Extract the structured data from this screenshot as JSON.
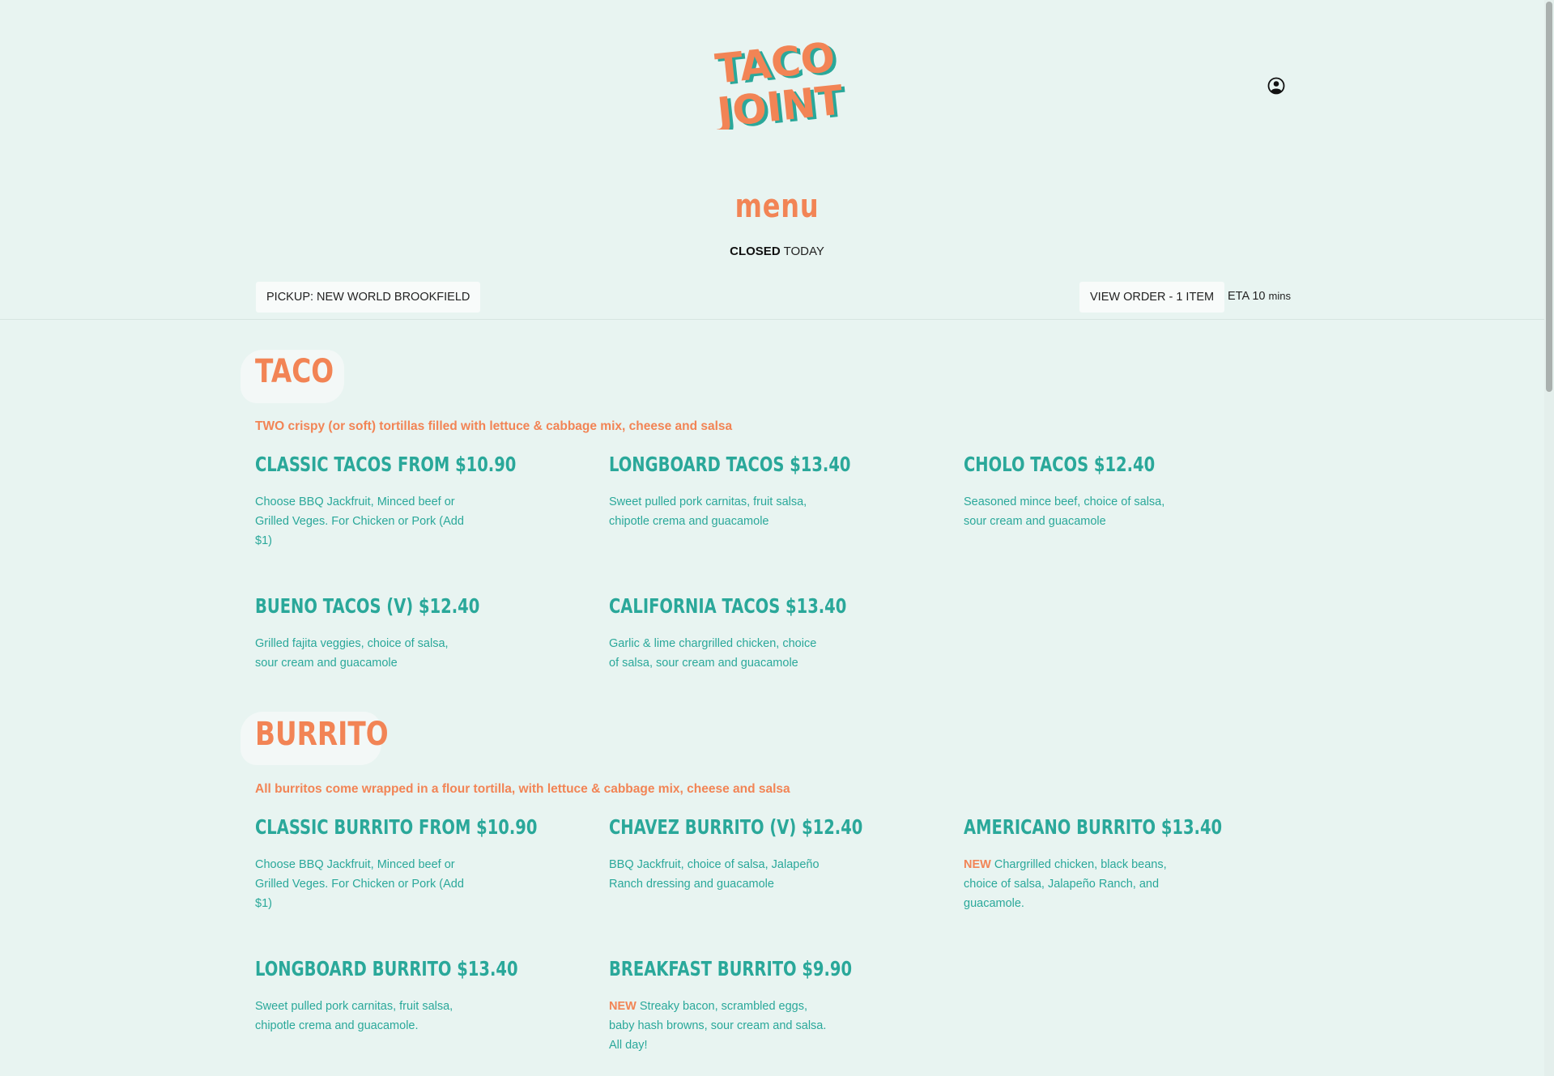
{
  "header": {
    "logo_line1": "TACO",
    "logo_line2": "JOINT"
  },
  "page_title": "menu",
  "status": {
    "closed": "CLOSED",
    "day": "TODAY"
  },
  "pickup_label": "PICKUP: NEW WORLD BROOKFIELD",
  "order_label": "VIEW ORDER - 1 ITEM",
  "eta": {
    "label": "ETA 10",
    "unit": "mins"
  },
  "colors": {
    "background": "#e8f4f1",
    "accent_orange": "#f28455",
    "accent_teal": "#2aa89a"
  },
  "categories": [
    {
      "name": "TACO",
      "description": "TWO crispy (or soft) tortillas filled with lettuce & cabbage mix, cheese and salsa",
      "items": [
        {
          "title": "Classic Tacos from $10.90",
          "new": "",
          "desc": "Choose BBQ Jackfruit, Minced beef or Grilled Veges. For Chicken or Pork (Add $1)"
        },
        {
          "title": "Longboard Tacos $13.40",
          "new": "",
          "desc": "Sweet pulled pork carnitas, fruit salsa, chipotle crema and guacamole"
        },
        {
          "title": "Cholo Tacos $12.40",
          "new": "",
          "desc": "Seasoned mince beef, choice of salsa, sour cream and guacamole"
        },
        {
          "title": "Bueno Tacos (V) $12.40",
          "new": "",
          "desc": "Grilled fajita veggies, choice of salsa, sour cream and guacamole"
        },
        {
          "title": "California Tacos $13.40",
          "new": "",
          "desc": "Garlic & lime chargrilled chicken, choice of salsa, sour cream and guacamole"
        }
      ]
    },
    {
      "name": "BURRITO",
      "description": "All burritos come wrapped in a flour tortilla, with lettuce & cabbage mix, cheese and salsa",
      "items": [
        {
          "title": "Classic Burrito from $10.90",
          "new": "",
          "desc": "Choose BBQ Jackfruit, Minced beef or Grilled Veges. For Chicken or Pork (Add $1)"
        },
        {
          "title": "Chavez Burrito (V) $12.40",
          "new": "",
          "desc": "BBQ Jackfruit, choice of salsa, Jalapeño Ranch dressing and guacamole"
        },
        {
          "title": "Americano Burrito $13.40",
          "new": "NEW",
          "desc": "Chargrilled chicken, black beans, choice of salsa, Jalapeño Ranch, and guacamole."
        },
        {
          "title": "Longboard Burrito $13.40",
          "new": "",
          "desc": "Sweet pulled pork carnitas, fruit salsa, chipotle crema and guacamole."
        },
        {
          "title": "Breakfast Burrito $9.90",
          "new": "NEW",
          "desc": "Streaky bacon, scrambled eggs, baby hash browns, sour cream and salsa. All day!"
        }
      ]
    }
  ]
}
